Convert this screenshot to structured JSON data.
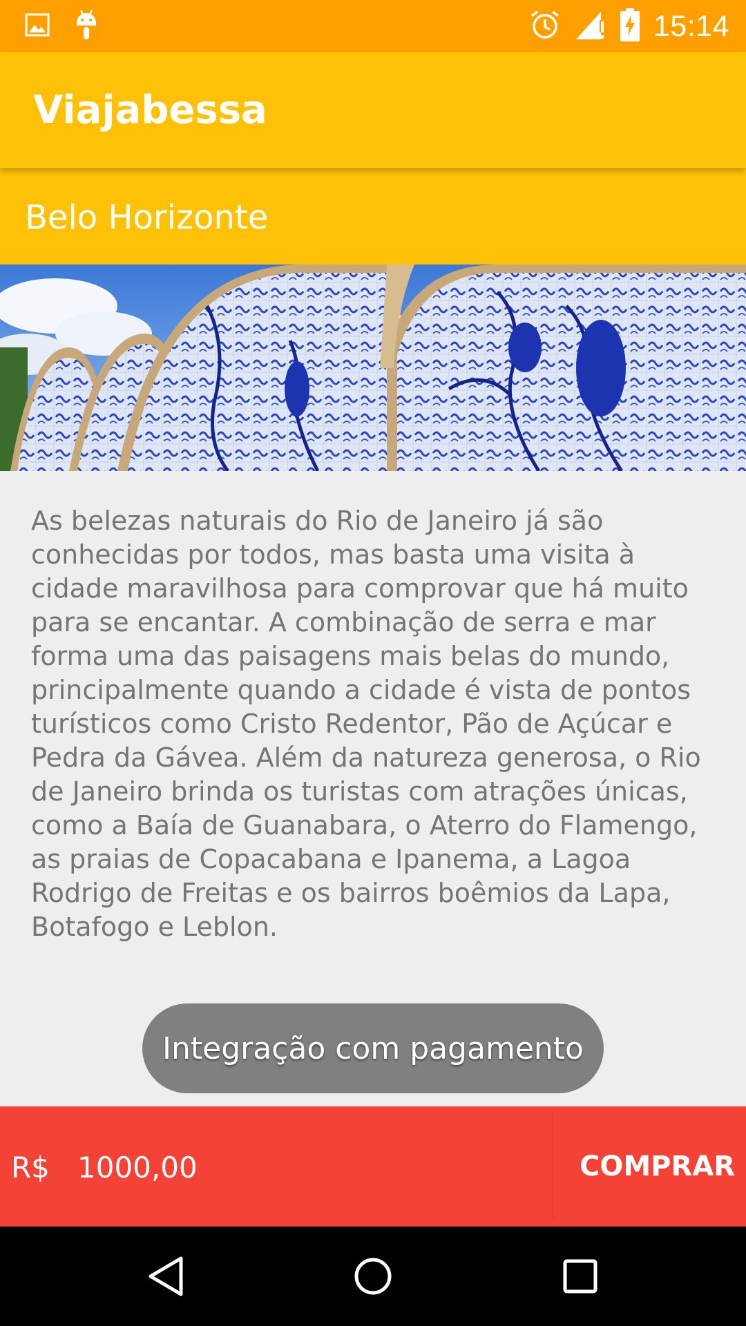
{
  "status_bar": {
    "time": "15:14",
    "icons": [
      "image-notification-icon",
      "android-notification-icon",
      "alarm-icon",
      "signal-icon",
      "battery-charging-icon"
    ]
  },
  "app_bar": {
    "title": "Viajabessa"
  },
  "package": {
    "city": "Belo Horizonte",
    "image": "azulejo-mural-photo",
    "description": "As belezas naturais do Rio de Janeiro já são conhecidas por todos, mas basta uma visita à cidade maravilhosa para comprovar que há muito para se encantar. A combinação de serra e mar forma uma das paisagens mais belas do mundo, principalmente quando a cidade é vista de pontos turísticos como Cristo Redentor, Pão de Açúcar e Pedra da Gávea. Além da natureza generosa, o Rio de Janeiro brinda os turistas com atrações únicas, como a Baía de Guanabara, o Aterro do Flamengo, as praias de Copacabana e Ipanema, a Lagoa Rodrigo de Freitas e os bairros boêmios da Lapa, Botafogo e Leblon."
  },
  "payment_button": {
    "label": "Integração com pagamento"
  },
  "buy_bar": {
    "currency": "R$",
    "price": "1000,00",
    "buy_label": "COMPRAR"
  },
  "nav": {
    "icons": [
      "back-icon",
      "home-icon",
      "recents-icon"
    ]
  },
  "colors": {
    "status_bar": "#ffa000",
    "primary": "#ffc107",
    "accent": "#f44336",
    "button_gray": "#808080"
  }
}
